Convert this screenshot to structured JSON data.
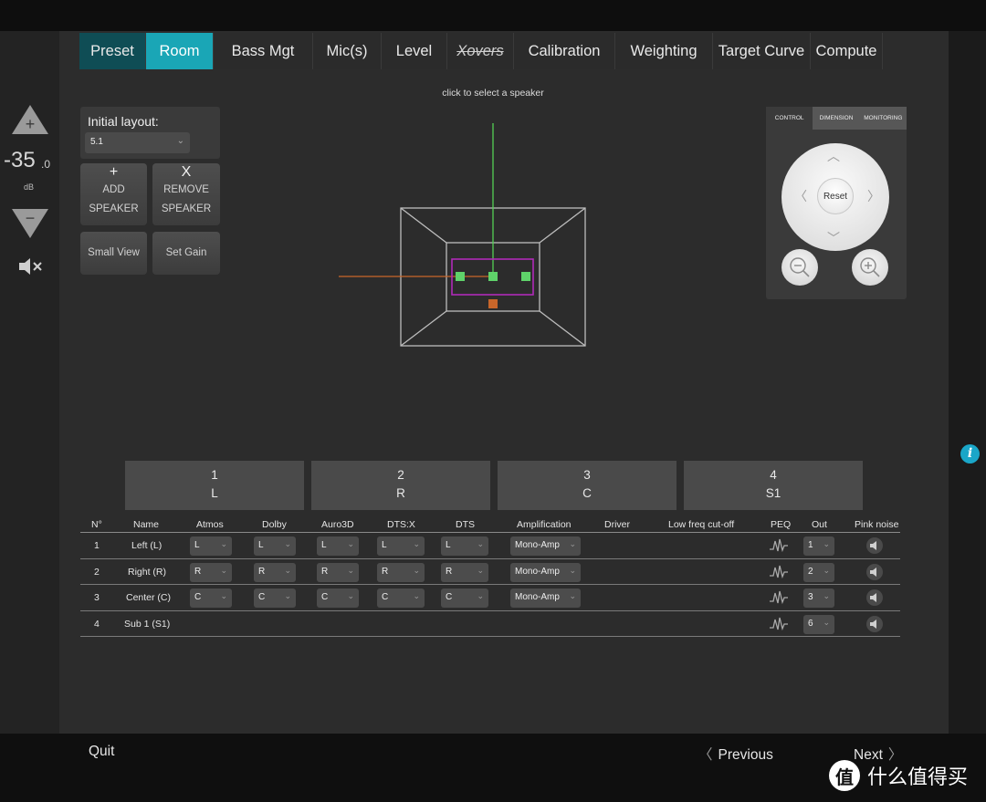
{
  "tabs": [
    {
      "label": "Preset"
    },
    {
      "label": "Room"
    },
    {
      "label": "Bass Mgt"
    },
    {
      "label": "Mic(s)"
    },
    {
      "label": "Level"
    },
    {
      "label": "Xovers"
    },
    {
      "label": "Calibration"
    },
    {
      "label": "Weighting"
    },
    {
      "label": "Target Curve"
    },
    {
      "label": "Compute"
    }
  ],
  "hint": "click to select a speaker",
  "volume": {
    "value": "-35",
    "decimal": ".0",
    "unit": "dB"
  },
  "layout": {
    "label": "Initial layout:",
    "value": "5.1"
  },
  "buttons": {
    "add_symbol": "+",
    "add_l1": "ADD",
    "add_l2": "SPEAKER",
    "remove_symbol": "X",
    "remove_l1": "REMOVE",
    "remove_l2": "SPEAKER",
    "small_view": "Small View",
    "set_gain": "Set Gain"
  },
  "control": {
    "tabs": [
      "CONTROL",
      "DIMENSION",
      "MONITORING"
    ],
    "reset": "Reset"
  },
  "tiles": [
    {
      "num": "1",
      "code": "L"
    },
    {
      "num": "2",
      "code": "R"
    },
    {
      "num": "3",
      "code": "C"
    },
    {
      "num": "4",
      "code": "S1"
    }
  ],
  "table": {
    "headers": [
      "N°",
      "Name",
      "Atmos",
      "Dolby",
      "Auro3D",
      "DTS:X",
      "DTS",
      "Amplification",
      "Driver",
      "Low freq cut-off",
      "PEQ",
      "Out",
      "Pink noise"
    ],
    "rows": [
      {
        "n": "1",
        "name": "Left (L)",
        "atmos": "L",
        "dolby": "L",
        "auro": "L",
        "dtsx": "L",
        "dts": "L",
        "amp": "Mono-Amp",
        "out": "1"
      },
      {
        "n": "2",
        "name": "Right (R)",
        "atmos": "R",
        "dolby": "R",
        "auro": "R",
        "dtsx": "R",
        "dts": "R",
        "amp": "Mono-Amp",
        "out": "2"
      },
      {
        "n": "3",
        "name": "Center (C)",
        "atmos": "C",
        "dolby": "C",
        "auro": "C",
        "dtsx": "C",
        "dts": "C",
        "amp": "Mono-Amp",
        "out": "3"
      },
      {
        "n": "4",
        "name": "Sub 1 (S1)",
        "atmos": "",
        "dolby": "",
        "auro": "",
        "dtsx": "",
        "dts": "",
        "amp": "",
        "out": "6"
      }
    ]
  },
  "footer": {
    "quit": "Quit",
    "previous": "Previous",
    "next": "Next"
  },
  "watermark": {
    "logo": "值",
    "text": "什么值得买"
  },
  "colors": {
    "accent": "#1aa6b6",
    "preset_tab": "#0f4d55",
    "speaker_green": "#5fd36a",
    "axis_green": "#55d155",
    "axis_orange": "#c8662a",
    "selection_magenta": "#b02ab8"
  },
  "icons": {
    "volume_up": "triangle-up-plus-icon",
    "volume_down": "triangle-down-minus-icon",
    "mute": "speaker-mute-icon",
    "peq": "waveform-icon",
    "pink_noise": "speaker-icon",
    "zoom_out": "magnifier-minus-icon",
    "zoom_in": "magnifier-plus-icon",
    "info": "info-icon"
  }
}
